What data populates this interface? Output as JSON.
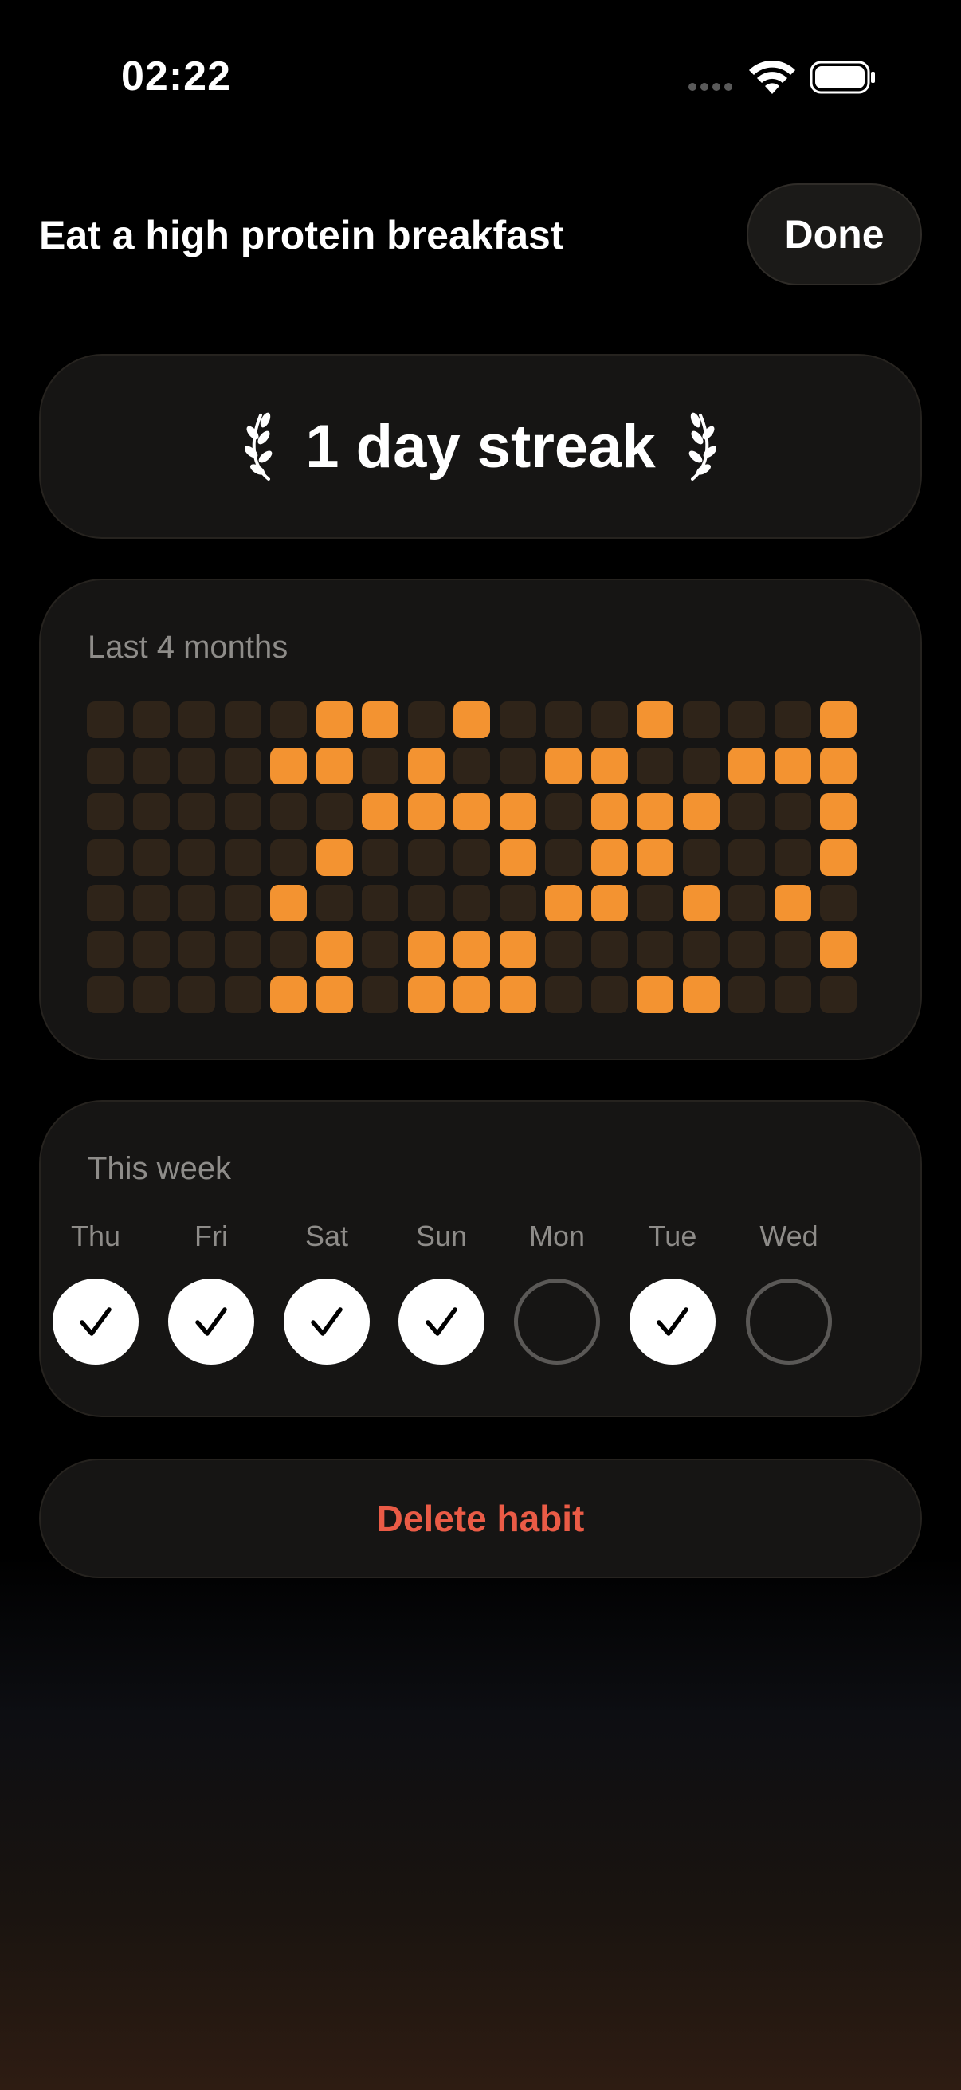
{
  "status_bar": {
    "time": "02:22"
  },
  "header": {
    "title": "Eat a high protein breakfast",
    "done_label": "Done"
  },
  "streak": {
    "text": "1 day streak",
    "icon": "laurel-icon"
  },
  "history": {
    "label": "Last 4 months",
    "accent_color": "#f39331",
    "inactive_color": "#2f2419",
    "columns": [
      [
        0,
        0,
        0,
        0,
        0,
        0,
        0
      ],
      [
        0,
        0,
        0,
        0,
        0,
        0,
        0
      ],
      [
        0,
        0,
        0,
        0,
        0,
        0,
        0
      ],
      [
        0,
        0,
        0,
        0,
        0,
        0,
        0
      ],
      [
        0,
        1,
        0,
        0,
        1,
        0,
        1
      ],
      [
        1,
        1,
        0,
        1,
        0,
        1,
        1
      ],
      [
        1,
        0,
        1,
        0,
        0,
        0,
        0
      ],
      [
        0,
        1,
        1,
        0,
        0,
        1,
        1
      ],
      [
        1,
        0,
        1,
        0,
        0,
        1,
        1
      ],
      [
        0,
        0,
        1,
        1,
        0,
        1,
        1
      ],
      [
        0,
        1,
        0,
        0,
        1,
        0,
        0
      ],
      [
        0,
        1,
        1,
        1,
        1,
        0,
        0
      ],
      [
        1,
        0,
        1,
        1,
        0,
        0,
        1
      ],
      [
        0,
        0,
        1,
        0,
        1,
        0,
        1
      ],
      [
        0,
        1,
        0,
        0,
        0,
        0,
        0
      ],
      [
        0,
        1,
        0,
        0,
        1,
        0,
        0
      ],
      [
        1,
        1,
        1,
        1,
        0,
        1,
        0
      ]
    ]
  },
  "week": {
    "label": "This week",
    "days": [
      {
        "label": "Thu",
        "done": true
      },
      {
        "label": "Fri",
        "done": true
      },
      {
        "label": "Sat",
        "done": true
      },
      {
        "label": "Sun",
        "done": true
      },
      {
        "label": "Mon",
        "done": false
      },
      {
        "label": "Tue",
        "done": true
      },
      {
        "label": "Wed",
        "done": false
      }
    ]
  },
  "delete_label": "Delete habit",
  "danger_color": "#ea5b46"
}
